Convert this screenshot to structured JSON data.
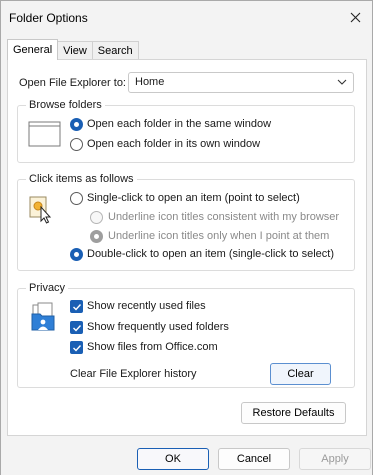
{
  "window": {
    "title": "Folder Options"
  },
  "tabs": [
    {
      "label": "General",
      "active": true
    },
    {
      "label": "View",
      "active": false
    },
    {
      "label": "Search",
      "active": false
    }
  ],
  "open_explorer": {
    "label": "Open File Explorer to:",
    "value": "Home"
  },
  "browse_folders": {
    "title": "Browse folders",
    "options": [
      {
        "label": "Open each folder in the same window",
        "checked": true
      },
      {
        "label": "Open each folder in its own window",
        "checked": false
      }
    ]
  },
  "click_items": {
    "title": "Click items as follows",
    "options": [
      {
        "label": "Single-click to open an item (point to select)",
        "checked": false
      },
      {
        "label": "Underline icon titles consistent with my browser",
        "checked": false,
        "disabled": true
      },
      {
        "label": "Underline icon titles only when I point at them",
        "checked": true,
        "disabled": true
      },
      {
        "label": "Double-click to open an item (single-click to select)",
        "checked": true
      }
    ]
  },
  "privacy": {
    "title": "Privacy",
    "options": [
      {
        "label": "Show recently used files",
        "checked": true
      },
      {
        "label": "Show frequently used folders",
        "checked": true
      },
      {
        "label": "Show files from Office.com",
        "checked": true
      }
    ],
    "clear_history_label": "Clear File Explorer history",
    "clear_button": "Clear"
  },
  "restore_defaults": "Restore Defaults",
  "footer": {
    "ok": "OK",
    "cancel": "Cancel",
    "apply": "Apply"
  },
  "colors": {
    "accent": "#1a5fb4",
    "window_bg": "#f3f3f3",
    "panel_bg": "#ffffff"
  }
}
